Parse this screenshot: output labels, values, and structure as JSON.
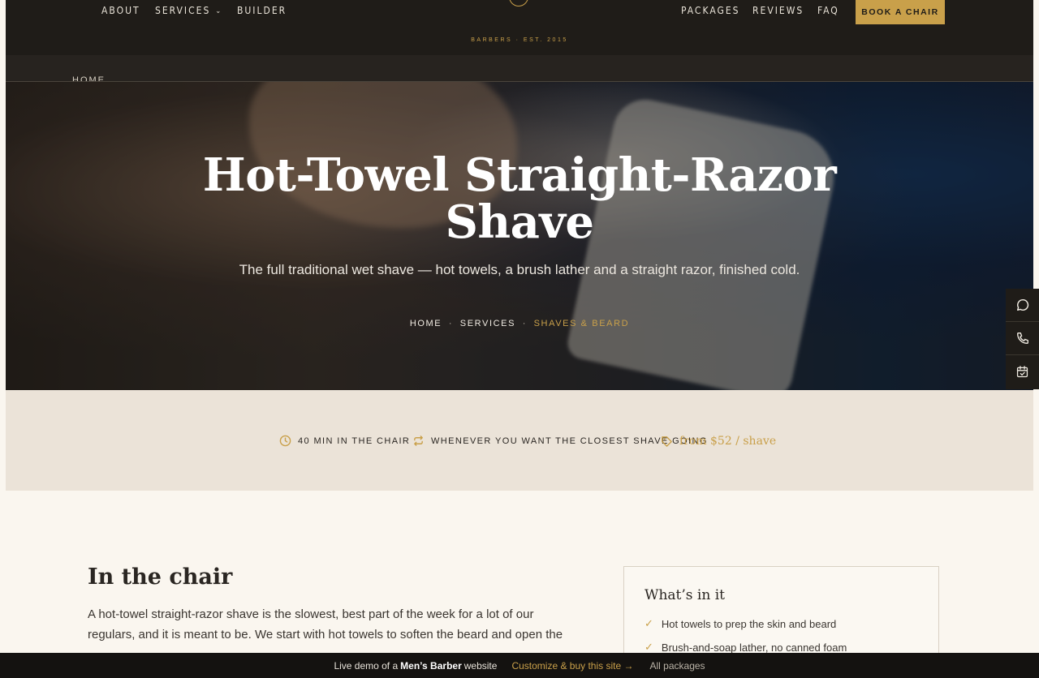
{
  "nav": {
    "left": [
      {
        "label": "ABOUT"
      },
      {
        "label": "SERVICES",
        "dropdown": true
      },
      {
        "label": "BUILDER"
      }
    ],
    "right": [
      {
        "label": "PACKAGES"
      },
      {
        "label": "REVIEWS"
      },
      {
        "label": "FAQ"
      }
    ],
    "cta": "BOOK A CHAIR",
    "tagline": "BARBERS · EST. 2015"
  },
  "subnav": {
    "home": "HOME"
  },
  "hero": {
    "title_line1": "Hot-Towel Straight-Razor",
    "title_line2": "Shave",
    "subtitle": "The full traditional wet shave — hot towels, a brush lather and a straight razor, finished cold.",
    "breadcrumb": {
      "home": "HOME",
      "services": "SERVICES",
      "current": "SHAVES & BEARD",
      "separator": "·"
    }
  },
  "facts": {
    "duration": "40 MIN IN THE CHAIR",
    "frequency": "WHENEVER YOU WANT THE CLOSEST SHAVE GOING",
    "price": "from $52 / shave"
  },
  "content": {
    "section_title": "In the chair",
    "paragraph": "A hot-towel straight-razor shave is the slowest, best part of the week for a lot of our regulars, and it is meant to be. We start with hot towels to soften the beard and open the"
  },
  "card": {
    "title": "What’s in it",
    "items": [
      "Hot towels to prep the skin and beard",
      "Brush-and-soap lather, no canned foam"
    ]
  },
  "bottombar": {
    "prefix": "Live demo of a",
    "site_type": "Men’s Barber",
    "suffix": "website",
    "customize": "Customize & buy this site →",
    "packages": "All packages"
  },
  "colors": {
    "accent": "#c9a04a",
    "dark": "#1f1c18",
    "cream": "#faf6ef",
    "strip": "#ebe3d8"
  },
  "icons": {
    "side": [
      "chat-icon",
      "phone-icon",
      "calendar-check-icon"
    ],
    "facts": [
      "clock-icon",
      "repeat-icon",
      "tag-icon"
    ]
  }
}
